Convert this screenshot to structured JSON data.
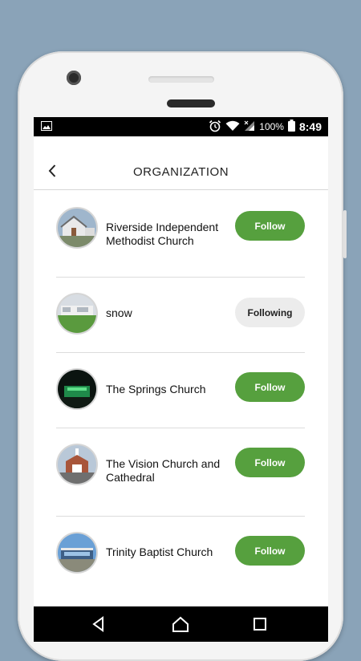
{
  "status_bar": {
    "battery_percent": "100%",
    "time": "8:49",
    "icons": [
      "image-icon",
      "alarm-icon",
      "wifi-icon",
      "signal-icon",
      "battery-icon"
    ]
  },
  "header": {
    "back_icon": "chevron-left-icon",
    "title": "ORGANIZATION"
  },
  "organizations": [
    {
      "name": "Riverside Independent Methodist Church",
      "button": "Follow",
      "state": "follow"
    },
    {
      "name": "snow",
      "button": "Following",
      "state": "following"
    },
    {
      "name": "The Springs Church",
      "button": "Follow",
      "state": "follow"
    },
    {
      "name": "The Vision Church and Cathedral",
      "button": "Follow",
      "state": "follow"
    },
    {
      "name": "Trinity Baptist Church",
      "button": "Follow",
      "state": "follow"
    }
  ],
  "nav_bar": {
    "icons": [
      "back-triangle-icon",
      "home-icon",
      "recents-icon"
    ]
  },
  "colors": {
    "accent": "#56a03e",
    "following_bg": "#ececec",
    "background": "#8aa3b8"
  }
}
